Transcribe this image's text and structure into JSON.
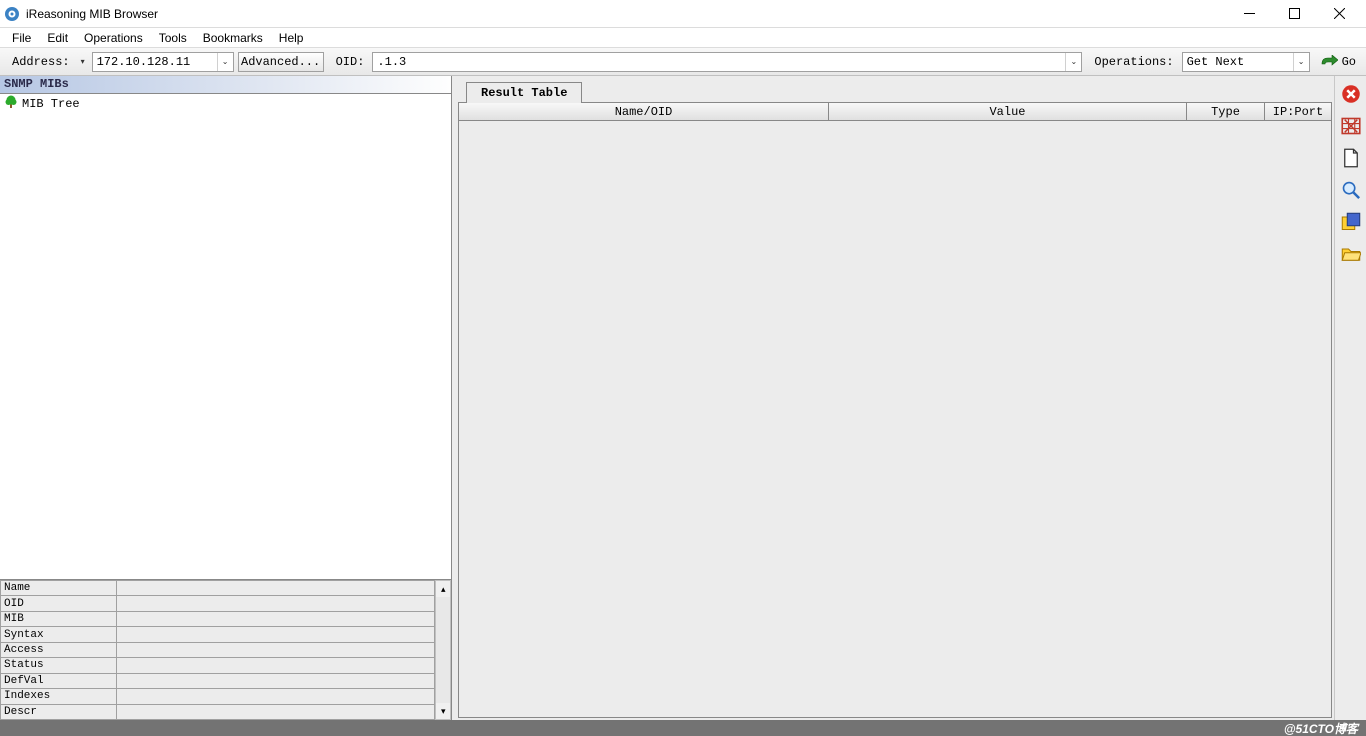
{
  "window": {
    "title": "iReasoning MIB Browser"
  },
  "menu": {
    "items": [
      "File",
      "Edit",
      "Operations",
      "Tools",
      "Bookmarks",
      "Help"
    ]
  },
  "toolbar": {
    "address_label": "Address:",
    "address_value": "172.10.128.11",
    "advanced_label": "Advanced...",
    "oid_label": "OID:",
    "oid_value": ".1.3",
    "operations_label": "Operations:",
    "operations_value": "Get Next",
    "go_label": "Go"
  },
  "left": {
    "header": "SNMP MIBs",
    "tree_root": "MIB Tree",
    "props": [
      {
        "k": "Name",
        "v": ""
      },
      {
        "k": "OID",
        "v": ""
      },
      {
        "k": "MIB",
        "v": ""
      },
      {
        "k": "Syntax",
        "v": ""
      },
      {
        "k": "Access",
        "v": ""
      },
      {
        "k": "Status",
        "v": ""
      },
      {
        "k": "DefVal",
        "v": ""
      },
      {
        "k": "Indexes",
        "v": ""
      },
      {
        "k": "Descr",
        "v": ""
      }
    ]
  },
  "result": {
    "tab_label": "Result Table",
    "columns": {
      "name": "Name/OID",
      "value": "Value",
      "type": "Type",
      "ipport": "IP:Port"
    },
    "rows": []
  },
  "rail": {
    "btns": [
      {
        "name": "clear-icon"
      },
      {
        "name": "table-options-icon"
      },
      {
        "name": "document-icon"
      },
      {
        "name": "search-icon"
      },
      {
        "name": "export-icon"
      },
      {
        "name": "open-folder-icon"
      }
    ]
  },
  "footer": {
    "watermark": "@51CTO博客"
  }
}
